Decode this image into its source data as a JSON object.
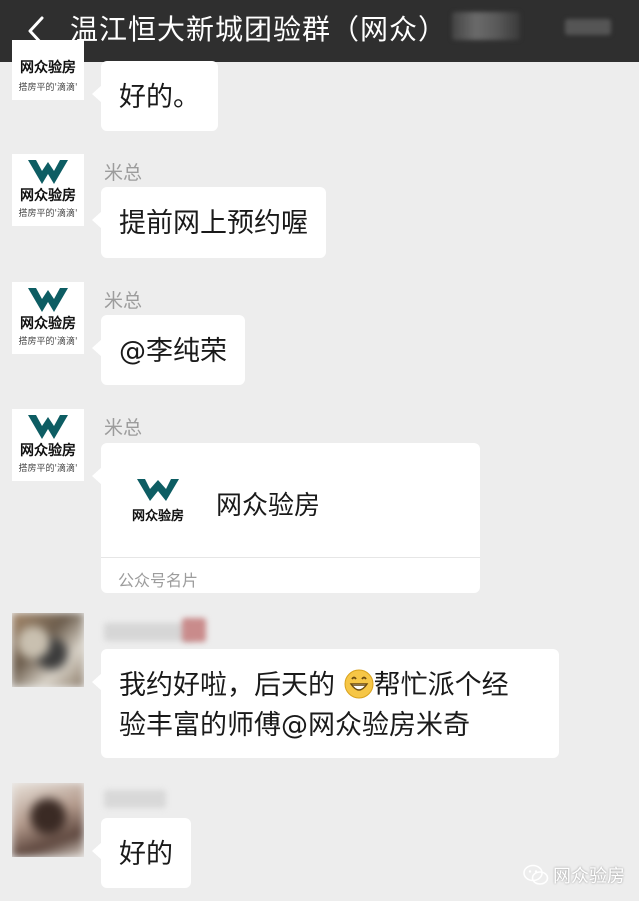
{
  "header": {
    "title": "温江恒大新城团验群（网众）"
  },
  "messages": [
    {
      "sender": "",
      "text": "好的。"
    },
    {
      "sender": "米总",
      "text": "提前网上预约喔"
    },
    {
      "sender": "米总",
      "text": "@李纯荣"
    },
    {
      "sender": "米总",
      "card": {
        "title": "网众验房",
        "footer": "公众号名片"
      }
    },
    {
      "sender": "",
      "lines": [
        "我约好啦，后天的 ",
        "帮忙派个经",
        "验丰富的师傅@网众验房米奇"
      ]
    },
    {
      "sender": "",
      "text": "好的"
    }
  ],
  "logo": {
    "brand": "网众验房",
    "slogan": "搭房平的'滴滴'"
  },
  "watermark": {
    "text": "网众验房"
  },
  "colors": {
    "topbar": "#2f2f2f",
    "background": "#ededed",
    "bubble": "#ffffff",
    "logo_teal": "#0d5d63"
  }
}
